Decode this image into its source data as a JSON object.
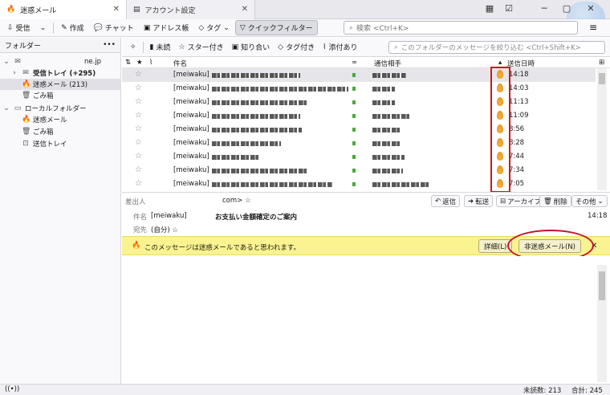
{
  "tabs": [
    {
      "label": "迷惑メール",
      "icon": "flame-icon"
    },
    {
      "label": "アカウント設定",
      "icon": "settings-page-icon"
    }
  ],
  "window_buttons": [
    "─",
    "▢",
    "✕"
  ],
  "toolbar": {
    "receive": "受信",
    "compose": "作成",
    "chat": "チャット",
    "address_book": "アドレス帳",
    "tag": "タグ",
    "quick_filter": "クイックフィルター",
    "search_placeholder": "検索 <Ctrl+K>",
    "menu": "≡"
  },
  "folder_pane": {
    "title": "フォルダー",
    "more": "•••",
    "items": [
      {
        "label": "ne.jp",
        "icon": "account-icon"
      },
      {
        "label": "受信トレイ (+295)",
        "icon": "inbox-icon"
      },
      {
        "label": "迷惑メール (213)",
        "icon": "flame-icon"
      },
      {
        "label": "ごみ箱",
        "icon": "trash-icon"
      },
      {
        "label": "ローカルフォルダー",
        "icon": "local-folder-icon"
      },
      {
        "label": "迷惑メール",
        "icon": "flame-icon"
      },
      {
        "label": "ごみ箱",
        "icon": "trash-icon"
      },
      {
        "label": "送信トレイ",
        "icon": "outbox-icon"
      }
    ]
  },
  "quick_filter": {
    "unread": "未読",
    "starred": "スター付き",
    "contacts": "知り合い",
    "tagged": "タグ付き",
    "attachment": "添付あり",
    "search_placeholder": "このフォルダーのメッセージを絞り込む <Ctrl+Shift+K>"
  },
  "columns": {
    "subject": "件名",
    "correspondent": "通信相手",
    "date": "送信日時"
  },
  "messages": [
    {
      "subject_prefix": "[meiwaku]",
      "time": "14:18"
    },
    {
      "subject_prefix": "[meiwaku]",
      "time": "14:03"
    },
    {
      "subject_prefix": "[meiwaku]",
      "time": "11:13"
    },
    {
      "subject_prefix": "[meiwaku]",
      "time": "11:09"
    },
    {
      "subject_prefix": "[meiwaku]",
      "time": "8:56"
    },
    {
      "subject_prefix": "[meiwaku]",
      "time": "8:28"
    },
    {
      "subject_prefix": "[meiwaku]",
      "time": "7:44"
    },
    {
      "subject_prefix": "[meiwaku]",
      "time": "7:34"
    },
    {
      "subject_prefix": "[meiwaku]",
      "time": "7:05"
    }
  ],
  "message_header": {
    "from_label": "差出人",
    "from_value": "com> ☆",
    "subject_label": "件名",
    "subject_prefix": "[meiwaku]",
    "subject_text": "お支払い金額確定のご案内",
    "to_label": "宛先",
    "to_value": "(自分) ☆",
    "time": "14:18",
    "reply": "返信",
    "forward": "転送",
    "archive": "アーカイブ",
    "delete": "削除",
    "other": "その他"
  },
  "junk_bar": {
    "message": "このメッセージは迷惑メールであると思われます。",
    "details": "詳細(L)",
    "not_junk": "非迷惑メール(N)",
    "close": "✕"
  },
  "status": {
    "unread_label": "未読数: 213",
    "total_label": "合計: 245"
  },
  "colors": {
    "highlight_red": "#d0161c",
    "junk_yellow": "#fbf38f",
    "flame": "#f0a030"
  }
}
